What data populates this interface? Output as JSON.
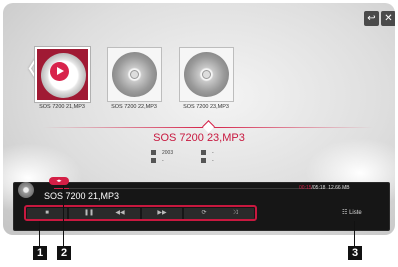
{
  "header": {
    "back_icon": "back-arrow-icon",
    "back_glyph": "↩",
    "close_glyph": "✕"
  },
  "carousel": {
    "prev_glyph": "〈",
    "items": [
      {
        "label": "SOS 7200 21,MP3",
        "selected": true
      },
      {
        "label": "SOS 7200 22,MP3",
        "selected": false
      },
      {
        "label": "SOS 7200 23,MP3",
        "selected": false
      }
    ]
  },
  "details": {
    "title": "SOS 7200 23,MP3",
    "year": "2003",
    "field2": "-",
    "field3": "-",
    "field4": "-"
  },
  "player": {
    "now_playing": "SOS 7200 21,MP3",
    "current_time": "00:15",
    "total_time": "/05:18",
    "file_size": "12.66 MB",
    "progress": 0.05,
    "handle_glyph": "◂▸",
    "controls": [
      {
        "name": "stop-button",
        "glyph": "■"
      },
      {
        "name": "pause-button",
        "glyph": "❚❚"
      },
      {
        "name": "rewind-button",
        "glyph": "◀◀"
      },
      {
        "name": "fast-forward-button",
        "glyph": "▶▶"
      },
      {
        "name": "repeat-button",
        "glyph": "⟳"
      },
      {
        "name": "shuffle-button",
        "glyph": "⤨"
      }
    ],
    "list_label": "Liste",
    "list_glyph": "☷"
  },
  "callouts": [
    "1",
    "2",
    "3"
  ],
  "colors": {
    "accent": "#c8183f",
    "panel": "#161616"
  }
}
